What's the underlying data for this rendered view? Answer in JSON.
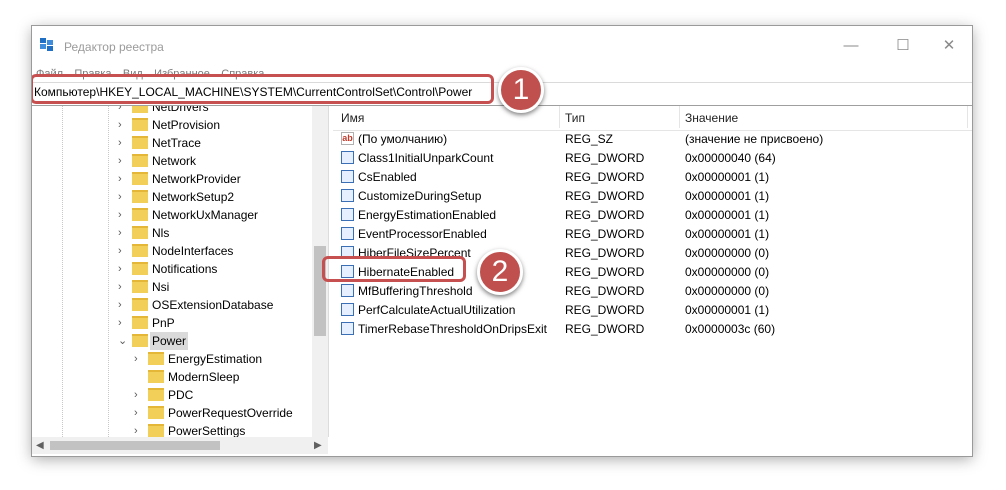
{
  "window": {
    "title": "Редактор реестра",
    "minimize_glyph": "—",
    "maximize_glyph": "☐",
    "close_glyph": "✕"
  },
  "menu": [
    "Файл",
    "Правка",
    "Вид",
    "Избранное",
    "Справка"
  ],
  "address": {
    "path": "Компьютер\\HKEY_LOCAL_MACHINE\\SYSTEM\\CurrentControlSet\\Control\\Power"
  },
  "badges": {
    "one": "1",
    "two": "2"
  },
  "tree": {
    "items": [
      {
        "label": "NetDrivers",
        "level": 1,
        "expander": "›"
      },
      {
        "label": "NetProvision",
        "level": 1,
        "expander": "›"
      },
      {
        "label": "NetTrace",
        "level": 1,
        "expander": "›"
      },
      {
        "label": "Network",
        "level": 1,
        "expander": "›"
      },
      {
        "label": "NetworkProvider",
        "level": 1,
        "expander": "›"
      },
      {
        "label": "NetworkSetup2",
        "level": 1,
        "expander": "›"
      },
      {
        "label": "NetworkUxManager",
        "level": 1,
        "expander": "›"
      },
      {
        "label": "Nls",
        "level": 1,
        "expander": "›"
      },
      {
        "label": "NodeInterfaces",
        "level": 1,
        "expander": "›"
      },
      {
        "label": "Notifications",
        "level": 1,
        "expander": "›"
      },
      {
        "label": "Nsi",
        "level": 1,
        "expander": "›"
      },
      {
        "label": "OSExtensionDatabase",
        "level": 1,
        "expander": "›"
      },
      {
        "label": "PnP",
        "level": 1,
        "expander": "›"
      },
      {
        "label": "Power",
        "level": 1,
        "expander": "⌄",
        "selected": true
      },
      {
        "label": "EnergyEstimation",
        "level": 2,
        "expander": "›"
      },
      {
        "label": "ModernSleep",
        "level": 2,
        "expander": ""
      },
      {
        "label": "PDC",
        "level": 2,
        "expander": "›"
      },
      {
        "label": "PowerRequestOverride",
        "level": 2,
        "expander": "›"
      },
      {
        "label": "PowerSettings",
        "level": 2,
        "expander": "›"
      }
    ]
  },
  "list": {
    "columns": {
      "name": "Имя",
      "type": "Тип",
      "value": "Значение"
    },
    "rows": [
      {
        "name": "(По умолчанию)",
        "type": "REG_SZ",
        "value": "(значение не присвоено)",
        "icon": "string-value-icon"
      },
      {
        "name": "Class1InitialUnparkCount",
        "type": "REG_DWORD",
        "value": "0x00000040 (64)",
        "icon": "dword-value-icon"
      },
      {
        "name": "CsEnabled",
        "type": "REG_DWORD",
        "value": "0x00000001 (1)",
        "icon": "dword-value-icon"
      },
      {
        "name": "CustomizeDuringSetup",
        "type": "REG_DWORD",
        "value": "0x00000001 (1)",
        "icon": "dword-value-icon"
      },
      {
        "name": "EnergyEstimationEnabled",
        "type": "REG_DWORD",
        "value": "0x00000001 (1)",
        "icon": "dword-value-icon"
      },
      {
        "name": "EventProcessorEnabled",
        "type": "REG_DWORD",
        "value": "0x00000001 (1)",
        "icon": "dword-value-icon"
      },
      {
        "name": "HiberFileSizePercent",
        "type": "REG_DWORD",
        "value": "0x00000000 (0)",
        "icon": "dword-value-icon"
      },
      {
        "name": "HibernateEnabled",
        "type": "REG_DWORD",
        "value": "0x00000000 (0)",
        "icon": "dword-value-icon"
      },
      {
        "name": "MfBufferingThreshold",
        "type": "REG_DWORD",
        "value": "0x00000000 (0)",
        "icon": "dword-value-icon"
      },
      {
        "name": "PerfCalculateActualUtilization",
        "type": "REG_DWORD",
        "value": "0x00000001 (1)",
        "icon": "dword-value-icon"
      },
      {
        "name": "TimerRebaseThresholdOnDripsExit",
        "type": "REG_DWORD",
        "value": "0x0000003c (60)",
        "icon": "dword-value-icon"
      }
    ]
  },
  "scroll": {
    "left_arrow": "◀",
    "right_arrow": "▶"
  },
  "colors": {
    "highlight": "#c6504f",
    "badge": "#c0504d",
    "folder": "#f2cf59"
  }
}
